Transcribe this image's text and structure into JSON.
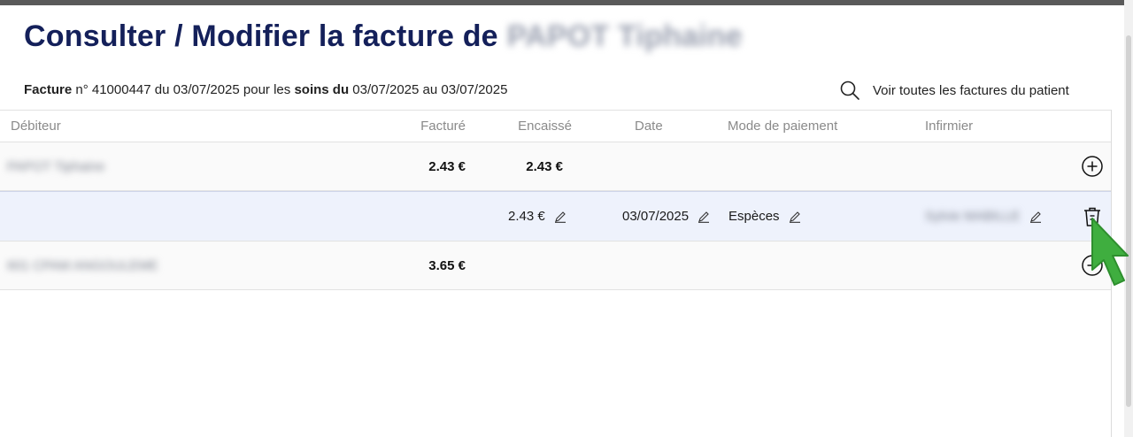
{
  "page": {
    "title": "Consulter / Modifier la facture de",
    "patient_name": "PAPOT Tiphaine"
  },
  "summary": {
    "facture_label": "Facture",
    "numero_prefix": "n° ",
    "numero": "41000447",
    "du_label": " du ",
    "date": "03/07/2025",
    "pour_les": " pour les ",
    "soins_du_label": "soins du",
    "soins_start": "03/07/2025",
    "au_label": " au ",
    "soins_end": "03/07/2025"
  },
  "actions": {
    "see_all_invoices": "Voir toutes les factures du patient"
  },
  "table": {
    "headers": {
      "debiteur": "Débiteur",
      "facture": "Facturé",
      "encaisse": "Encaissé",
      "date": "Date",
      "mode": "Mode de paiement",
      "infirmier": "Infirmier"
    },
    "debtors": [
      {
        "name": "PAPOT Tiphaine",
        "facture": "2.43 €",
        "encaisse": "2.43 €",
        "payments": [
          {
            "encaisse": "2.43 €",
            "date": "03/07/2025",
            "mode": "Espèces",
            "infirmier": "Sylvie MABILLE"
          }
        ]
      },
      {
        "name": "601 CPAM ANGOULEME",
        "facture": "3.65 €",
        "encaisse": ""
      }
    ]
  },
  "icons": {
    "search": "search-icon",
    "add": "plus-circle-icon",
    "edit": "pencil-icon",
    "delete": "trash-icon",
    "cursor": "pointer-cursor-icon"
  },
  "colors": {
    "title": "#14205a",
    "selected_row": "#eef2fc",
    "cursor": "#3fae3f"
  }
}
